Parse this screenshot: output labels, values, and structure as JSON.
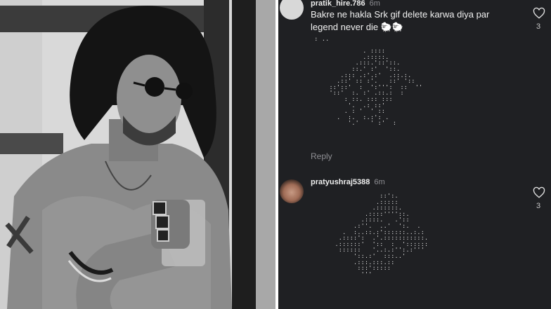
{
  "comments": [
    {
      "username": "pratik_hire.786",
      "time": "6m",
      "text_line1": "Bakre ne hakla Srk gif delete karwa diya par",
      "text_line2": "legend never die 🐑🐑",
      "reply_label": "Reply",
      "like_count": "3"
    },
    {
      "username": "pratyushraj5388",
      "time": "6m",
      "like_count": "3"
    }
  ],
  "colors": {
    "panel_background": "#1f2023",
    "text_primary": "#f1f1f1",
    "text_secondary": "#8e8e93"
  },
  "icons": [
    "heart-icon",
    "avatar"
  ]
}
